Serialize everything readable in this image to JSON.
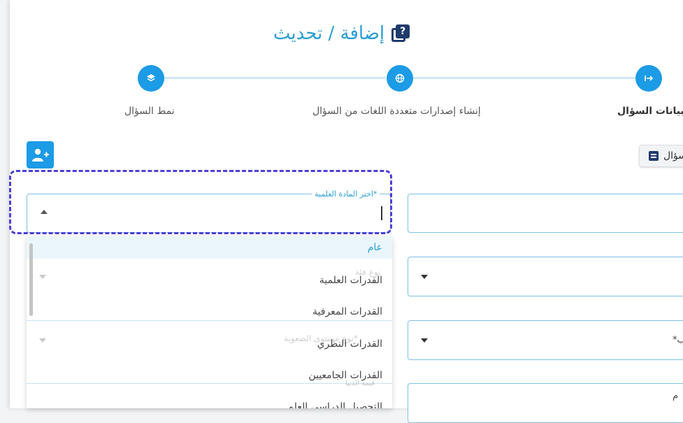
{
  "header": {
    "title": "إضافة / تحديث",
    "icon": "question-box-icon"
  },
  "stepper": {
    "steps": [
      {
        "label": "نمط السؤال",
        "icon": "layers-icon"
      },
      {
        "label": "إنشاء إصدارات متعددة اللغات من السؤال",
        "icon": "globe-icon"
      },
      {
        "label": "بيانات السؤال",
        "icon": "arrow-to-line-icon",
        "active": true
      }
    ]
  },
  "toolbar": {
    "add_user_icon": "user-plus-icon",
    "side_button_label": "سؤال"
  },
  "subject_select": {
    "label": "اختر المادة العلمية*",
    "options": [
      "عام",
      "القدرات العلمية",
      "القدرات المعرفية",
      "القدرات النظري",
      "القدرات الجامعيين",
      "التحصيل الدراسي العلم"
    ]
  },
  "background_fields": {
    "ghost_1": "نوع فئة",
    "ghost_2": "نوع مستوى الصعوبة*",
    "ghost_3": "قيمة الدنيا",
    "right_2_text": "*ب",
    "right_3_text": "م"
  },
  "colors": {
    "accent": "#1c9be6",
    "title": "#2a9fd6",
    "focus": "#4c3fd6",
    "dark_icon": "#1f3b6b"
  }
}
